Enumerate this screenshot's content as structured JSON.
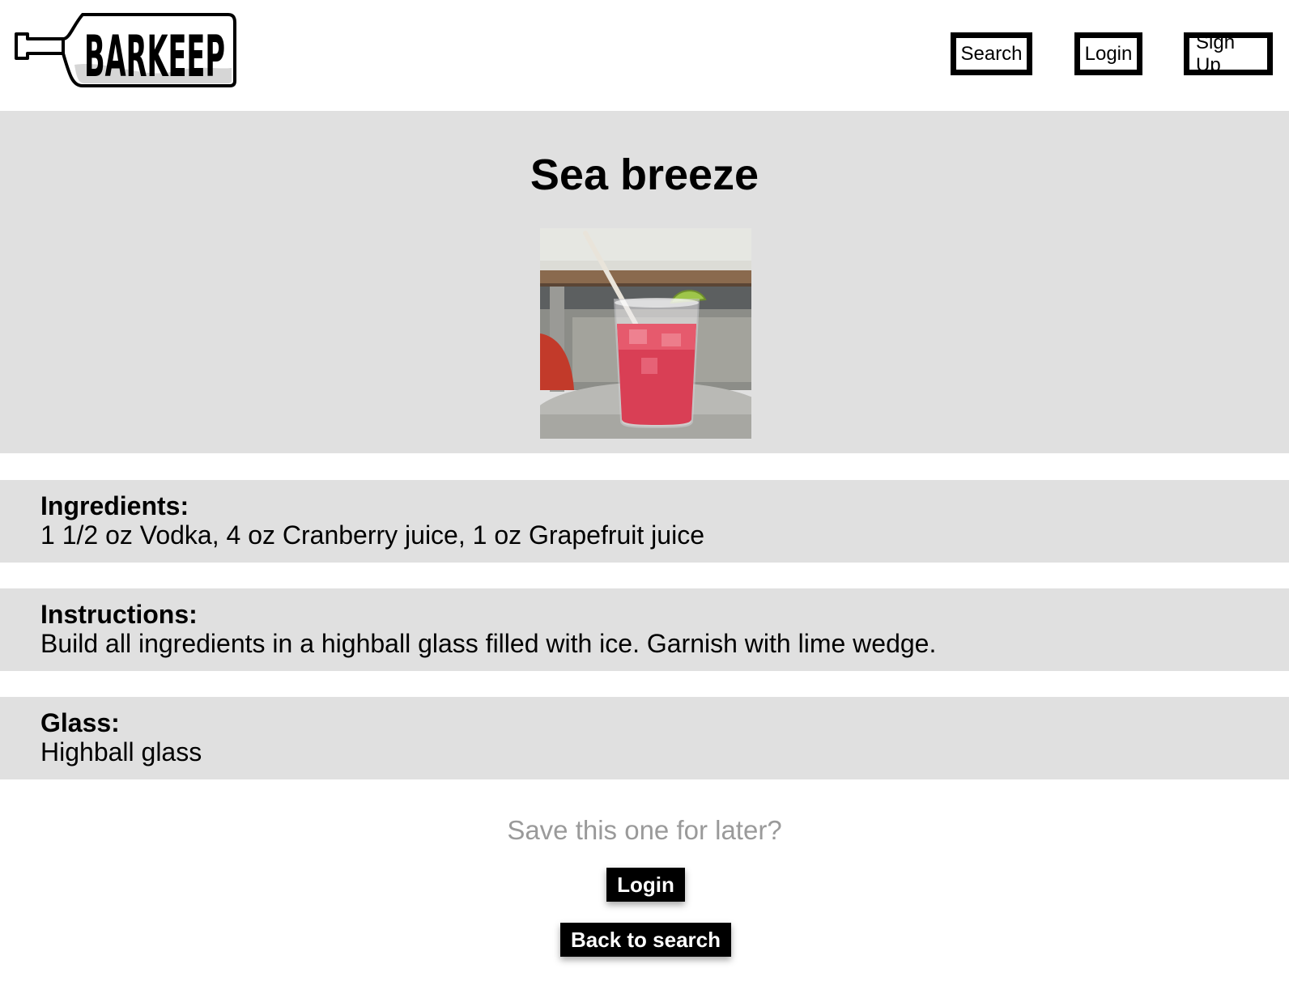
{
  "header": {
    "logo_text": "BARKEEP",
    "nav": {
      "search_label": "Search",
      "login_label": "Login",
      "signup_label": "Sign Up"
    }
  },
  "drink": {
    "name": "Sea breeze",
    "image_alt": "Sea breeze cocktail in highball glass with lime wedge and straw"
  },
  "sections": {
    "ingredients": {
      "label": "Ingredients:",
      "value": "1 1/2 oz Vodka, 4 oz Cranberry juice, 1 oz Grapefruit juice"
    },
    "instructions": {
      "label": "Instructions:",
      "value": "Build all ingredients in a highball glass filled with ice. Garnish with lime wedge."
    },
    "glass": {
      "label": "Glass:",
      "value": "Highball glass"
    }
  },
  "footer": {
    "save_prompt": "Save this one for later?",
    "login_label": "Login",
    "back_label": "Back to search"
  },
  "colors": {
    "panel_bg": "#e0e0e0",
    "prompt_text": "#9a9a9a",
    "button_bg": "#000000"
  }
}
